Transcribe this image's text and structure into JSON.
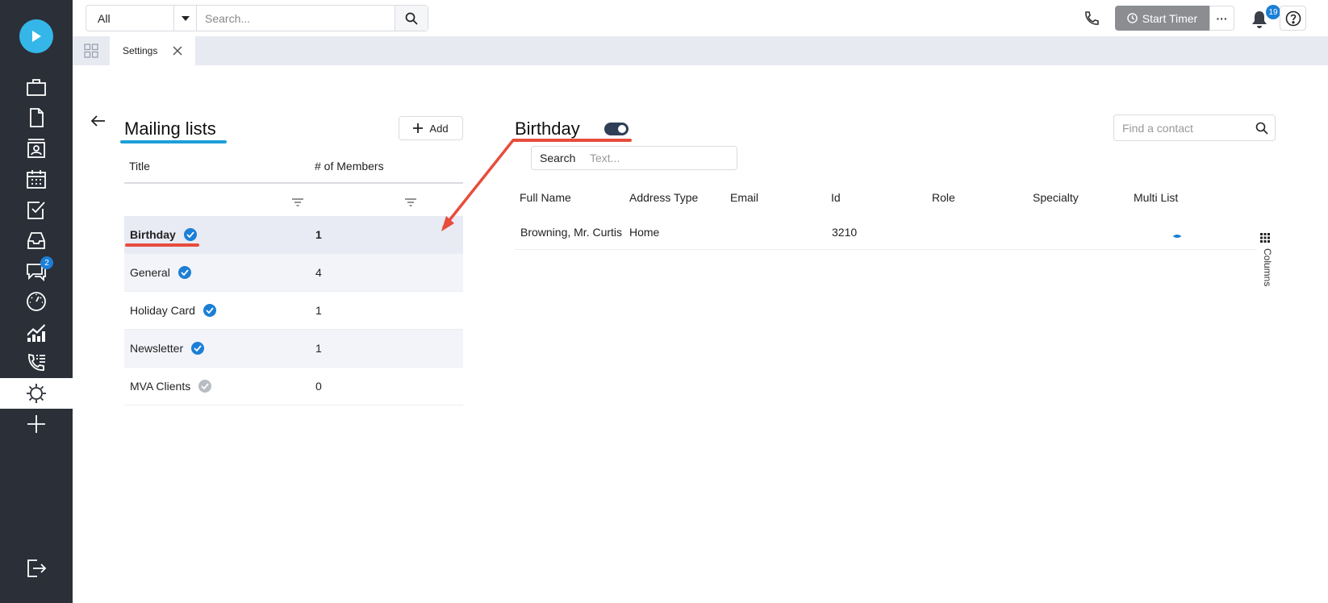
{
  "topbar": {
    "scope_value": "All",
    "search_placeholder": "Search...",
    "timer_label": "Start Timer",
    "more_label": "···",
    "notifications_count": "19"
  },
  "sidebar": {
    "messages_badge": "2",
    "icons": [
      "briefcase-icon",
      "document-icon",
      "contact-card-icon",
      "calendar-icon",
      "checklist-icon",
      "inbox-icon",
      "chat-icon",
      "dashboard-icon",
      "reports-icon",
      "call-log-icon",
      "settings-icon",
      "plus-icon",
      "logout-icon"
    ]
  },
  "tabs": {
    "items": [
      {
        "label": "Settings"
      }
    ]
  },
  "mailing_lists": {
    "title": "Mailing lists",
    "add_label": "Add",
    "columns": {
      "title": "Title",
      "members": "# of Members"
    },
    "rows": [
      {
        "name": "Birthday",
        "members": "1",
        "active": true,
        "selected": true
      },
      {
        "name": "General",
        "members": "4",
        "active": true,
        "selected": false
      },
      {
        "name": "Holiday Card",
        "members": "1",
        "active": true,
        "selected": false
      },
      {
        "name": "Newsletter",
        "members": "1",
        "active": true,
        "selected": false
      },
      {
        "name": "MVA Clients",
        "members": "0",
        "active": false,
        "selected": false
      }
    ]
  },
  "detail": {
    "title": "Birthday",
    "find_placeholder": "Find a contact",
    "search_label": "Search",
    "search_placeholder": "Text...",
    "columns": {
      "full_name": "Full Name",
      "address_type": "Address Type",
      "email": "Email",
      "id": "Id",
      "role": "Role",
      "specialty": "Specialty",
      "multi_list": "Multi List"
    },
    "rows": [
      {
        "full_name": "Browning, Mr. Curtis",
        "address_type": "Home",
        "email": "",
        "id": "3210",
        "role": "",
        "specialty": "",
        "multi_list": true
      }
    ],
    "columns_label": "Columns"
  },
  "colors": {
    "sidebar_bg": "#2b2f38",
    "logo": "#35b6e9",
    "accent_blue": "#1c7fd6",
    "annotation_red": "#e74c3c",
    "title_underline": "#1e9fd9"
  }
}
